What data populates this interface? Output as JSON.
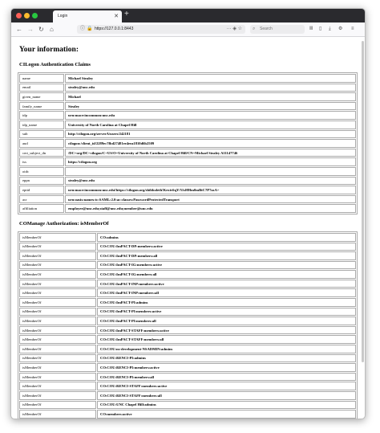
{
  "browser": {
    "tab_title": "Login",
    "url": "https://127.0.0.1:8443",
    "search_placeholder": "Search"
  },
  "page": {
    "heading": "Your information:",
    "claims_title": "CILogon Authentication Claims",
    "claims": [
      {
        "key": "name",
        "value": "Michael Stealey"
      },
      {
        "key": "email",
        "value": "stealey@unc.edu"
      },
      {
        "key": "given_name",
        "value": "Michael"
      },
      {
        "key": "family_name",
        "value": "Stealey"
      },
      {
        "key": "idp",
        "value": "urn:mace:incommon:unc.edu"
      },
      {
        "key": "idp_name",
        "value": "University of North Carolina at Chapel Hill"
      },
      {
        "key": "sub",
        "value": "http://cilogon.org/serverA/users/242181"
      },
      {
        "key": "aud",
        "value": "cilogon:/client_id/2289ec7fbd27481ee4eea1810d6b2509"
      },
      {
        "key": "cert_subject_dn",
        "value": "/DC=org/DC=cilogon/C=US/O=University of North Carolina at Chapel Hill/CN=Michael Stealey A11147746"
      },
      {
        "key": "iss",
        "value": "https://cilogon.org"
      },
      {
        "key": "oidc",
        "value": ""
      },
      {
        "key": "eppn",
        "value": "stealey@unc.edu"
      },
      {
        "key": "eptid",
        "value": "urn:mace:incommon:unc.edu!https://cilogon.org/shibboleth!Kexiv6qY/51sHHm0mBtC7P7zzA="
      },
      {
        "key": "acr",
        "value": "urn:oasis:names:tc:SAML:2.0:ac:classes:PasswordProtectedTransport"
      },
      {
        "key": "affiliation",
        "value": "employee@unc.edu;staff@unc.edu;member@unc.edu"
      }
    ],
    "ismember_title": "COManage Authorization: isMemberOf",
    "ismember": [
      {
        "key": "isMemberOf",
        "value": "CO:admins"
      },
      {
        "key": "isMemberOf",
        "value": "CO:COU:ImPACT-DP:members:active"
      },
      {
        "key": "isMemberOf",
        "value": "CO:COU:ImPACT-DP:members:all"
      },
      {
        "key": "isMemberOf",
        "value": "CO:COU:ImPACT-IG:members:active"
      },
      {
        "key": "isMemberOf",
        "value": "CO:COU:ImPACT-IG:members:all"
      },
      {
        "key": "isMemberOf",
        "value": "CO:COU:ImPACT-INP:members:active"
      },
      {
        "key": "isMemberOf",
        "value": "CO:COU:ImPACT-INP:members:all"
      },
      {
        "key": "isMemberOf",
        "value": "CO:COU:ImPACT-PI:admins"
      },
      {
        "key": "isMemberOf",
        "value": "CO:COU:ImPACT-PI:members:active"
      },
      {
        "key": "isMemberOf",
        "value": "CO:COU:ImPACT-PI:members:all"
      },
      {
        "key": "isMemberOf",
        "value": "CO:COU:ImPACT-STAFF:members:active"
      },
      {
        "key": "isMemberOf",
        "value": "CO:COU:ImPACT-STAFF:members:all"
      },
      {
        "key": "isMemberOf",
        "value": "CO:COU:ns-development-NSADMIN:admins"
      },
      {
        "key": "isMemberOf",
        "value": "CO:COU:RENCI-PI:admins"
      },
      {
        "key": "isMemberOf",
        "value": "CO:COU:RENCI-PI:members:active"
      },
      {
        "key": "isMemberOf",
        "value": "CO:COU:RENCI-PI:members:all"
      },
      {
        "key": "isMemberOf",
        "value": "CO:COU:RENCI-STAFF:members:active"
      },
      {
        "key": "isMemberOf",
        "value": "CO:COU:RENCI-STAFF:members:all"
      },
      {
        "key": "isMemberOf",
        "value": "CO:COU:UNC Chapel Hill:admins"
      },
      {
        "key": "isMemberOf",
        "value": "CO:members:active"
      }
    ]
  }
}
